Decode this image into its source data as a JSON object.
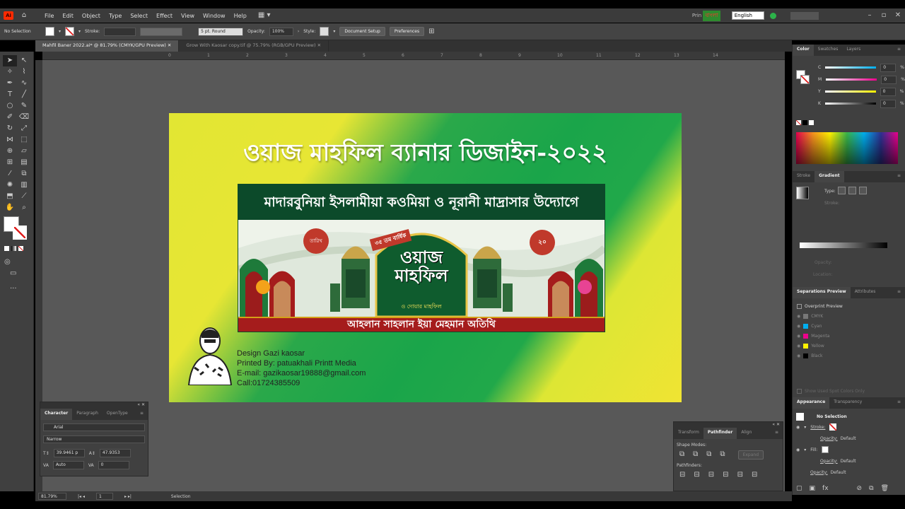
{
  "menu": [
    "File",
    "Edit",
    "Object",
    "Type",
    "Select",
    "Effect",
    "View",
    "Window",
    "Help"
  ],
  "system": {
    "print": "Prin",
    "bangla": "বাংলা",
    "lang": "English"
  },
  "control": {
    "no_selection": "No Selection",
    "stroke_label": "Stroke:",
    "brush": "5 pt. Round",
    "opacity_label": "Opacity:",
    "opacity": "100%",
    "style_label": "Style:",
    "doc_setup": "Document Setup",
    "preferences": "Preferences"
  },
  "doc_tabs": [
    "Mahfil Baner 2022.ai* @ 81.79% (CMYK/GPU Preview)",
    "Grow With Kaosar copy.tif @ 75.79% (RGB/GPU Preview)"
  ],
  "ruler": [
    "0",
    "1",
    "2",
    "3",
    "4",
    "5",
    "6",
    "7",
    "8",
    "9",
    "10",
    "11",
    "12",
    "13",
    "14"
  ],
  "banner": {
    "title": "ওয়াজ মাহফিল ব্যানার ডিজাইন-২০২২",
    "top_strip": "মাদারবুনিয়া ইসলামীয়া কওমিয়া ও নূরানী মাদ্রাসার উদ্যোগে",
    "badge": "৩৫ তম বার্ষিক",
    "center_title": "ওয়াজ মাহফিল",
    "center_sub": "ও দোয়ার মাহফিল",
    "left_bubble": "তারিখ",
    "right_bubble": "২০",
    "bottom_strip": "আহলান সাহলান ইয়া মেহমান অতিথি"
  },
  "credits": [
    "Design Gazi kaosar",
    "Printed By: patuakhali Printt Media",
    "E-mail: gazikaosar19888@gmail.com",
    "Call:01724385509"
  ],
  "character_panel": {
    "tabs": [
      "Character",
      "Paragraph",
      "OpenType"
    ],
    "font": "Arial",
    "style": "Narrow",
    "size": "39.9461 p",
    "leading": "47.9353",
    "kerning": "Auto",
    "tracking": "0"
  },
  "color_panel": {
    "tabs": [
      "Color",
      "Swatches",
      "Layers"
    ],
    "channels": [
      {
        "k": "C",
        "v": "0",
        "c": "#00aeef"
      },
      {
        "k": "M",
        "v": "0",
        "c": "#ec008c"
      },
      {
        "k": "Y",
        "v": "0",
        "c": "#fff200"
      },
      {
        "k": "K",
        "v": "0",
        "c": "#000"
      }
    ]
  },
  "gradient_panel": {
    "tabs": [
      "Stroke",
      "Gradient"
    ],
    "type": "Type:",
    "stroke": "Stroke:",
    "opacity": "Opacity:",
    "location": "Location:"
  },
  "separations": {
    "tabs": [
      "Separations Preview",
      "Attributes"
    ],
    "overprint": "Overprint Preview",
    "inks": [
      {
        "n": "CMYK",
        "c": "#777"
      },
      {
        "n": "Cyan",
        "c": "#00aeef"
      },
      {
        "n": "Magenta",
        "c": "#ec008c"
      },
      {
        "n": "Yellow",
        "c": "#fff200"
      },
      {
        "n": "Black",
        "c": "#000"
      }
    ],
    "spot": "Show Used Spot Colors Only"
  },
  "appearance": {
    "tabs": [
      "Appearance",
      "Transparency"
    ],
    "no_sel": "No Selection",
    "stroke": "Stroke:",
    "fill": "Fill:",
    "opacity": "Opacity:",
    "default": "Default"
  },
  "pathfinder": {
    "tabs": [
      "Transform",
      "Pathfinder",
      "Align"
    ],
    "shape_modes": "Shape Modes:",
    "pathfinders": "Pathfinders:",
    "expand": "Expand"
  },
  "status": {
    "zoom": "81.79%",
    "artboard": "1",
    "tool": "Selection"
  }
}
